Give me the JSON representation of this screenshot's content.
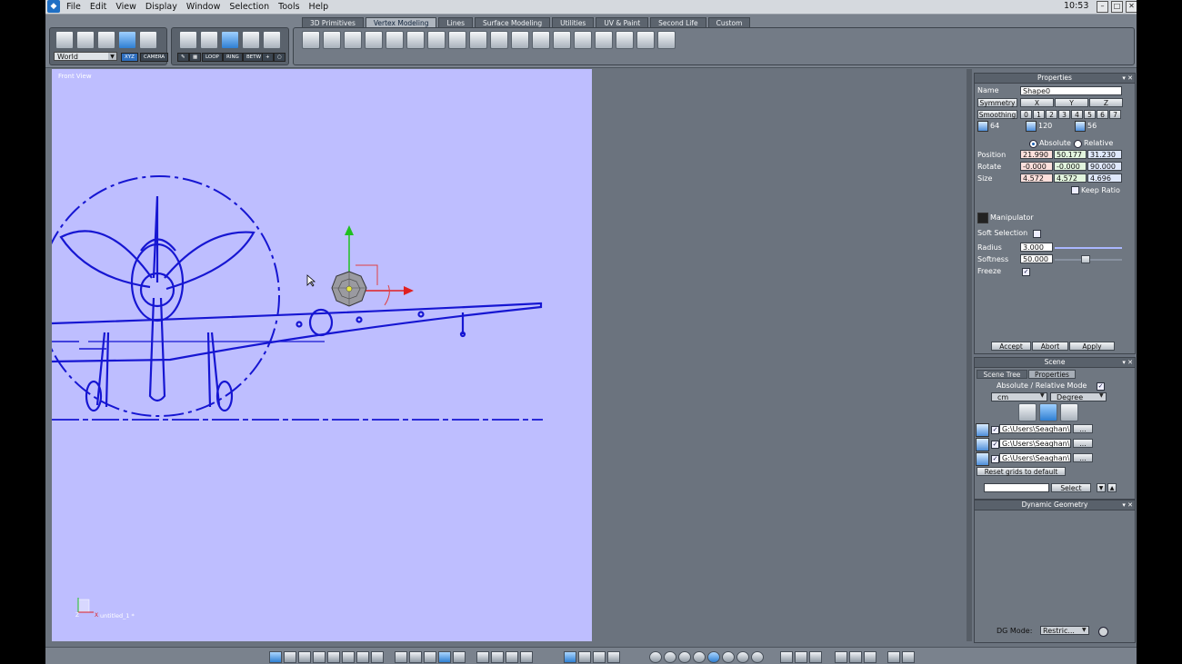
{
  "menu": [
    "File",
    "Edit",
    "View",
    "Display",
    "Window",
    "Selection",
    "Tools",
    "Help"
  ],
  "clock": "10:53",
  "window_buttons": [
    "–",
    "□",
    "✕"
  ],
  "toolbar": {
    "tabs": [
      "3D Primitives",
      "Vertex Modeling",
      "Lines",
      "Surface Modeling",
      "Utilities",
      "UV & Paint",
      "Second Life",
      "Custom"
    ],
    "active_tab": "Vertex Modeling",
    "coord_space": "World",
    "xyz_label": "XYZ",
    "camera_label": "CAMERA",
    "loop_label": "LOOP",
    "ring_label": "RING",
    "betw_label": "BETW"
  },
  "viewport": {
    "label": "Front View",
    "file_name": "untitled_1 *",
    "axis_z": "Z",
    "axis_x": "X",
    "background": "#bebeff",
    "blueprint_color": "#1616d2"
  },
  "properties": {
    "title": "Properties",
    "name_label": "Name",
    "name_value": "Shape0",
    "symmetry_label": "Symmetry",
    "symmetry_axes": [
      "X",
      "Y",
      "Z"
    ],
    "smoothing_label": "Smoothing",
    "smoothing_levels": [
      "0",
      "1",
      "2",
      "3",
      "4",
      "5",
      "6",
      "7"
    ],
    "counts": [
      "64",
      "120",
      "56"
    ],
    "absolute_label": "Absolute",
    "relative_label": "Relative",
    "position_label": "Position",
    "position": [
      "21.990",
      "50.177",
      "31.230"
    ],
    "rotate_label": "Rotate",
    "rotate": [
      "-0.000",
      "-0.000",
      "90.000"
    ],
    "size_label": "Size",
    "size": [
      "4.572",
      "4.572",
      "4.696"
    ],
    "keep_ratio_label": "Keep Ratio",
    "manipulator_label": "Manipulator",
    "soft_selection_label": "Soft Selection",
    "radius_label": "Radius",
    "radius_value": "3.000",
    "softness_label": "Softness",
    "softness_value": "50.000",
    "freeze_label": "Freeze",
    "accept_label": "Accept",
    "abort_label": "Abort",
    "apply_label": "Apply"
  },
  "scene": {
    "title": "Scene",
    "tab_tree": "Scene Tree",
    "tab_properties": "Properties",
    "mode_label": "Absolute / Relative Mode",
    "unit": "cm",
    "angle_unit": "Degree",
    "grid_paths": [
      "G:\\Users\\Seaghan\\",
      "G:\\Users\\Seaghan\\",
      "G:\\Users\\Seaghan\\"
    ],
    "browse_label": "...",
    "reset_label": "Reset grids to default",
    "select_label": "Select"
  },
  "dynamic_geometry": {
    "title": "Dynamic Geometry",
    "dg_mode_label": "DG Mode:",
    "dg_mode_value": "Restric..."
  },
  "colors": {
    "accent": "#2f7fd2",
    "x_axis": "#e02020",
    "y_axis": "#20c020",
    "panel": "#6f7781"
  }
}
